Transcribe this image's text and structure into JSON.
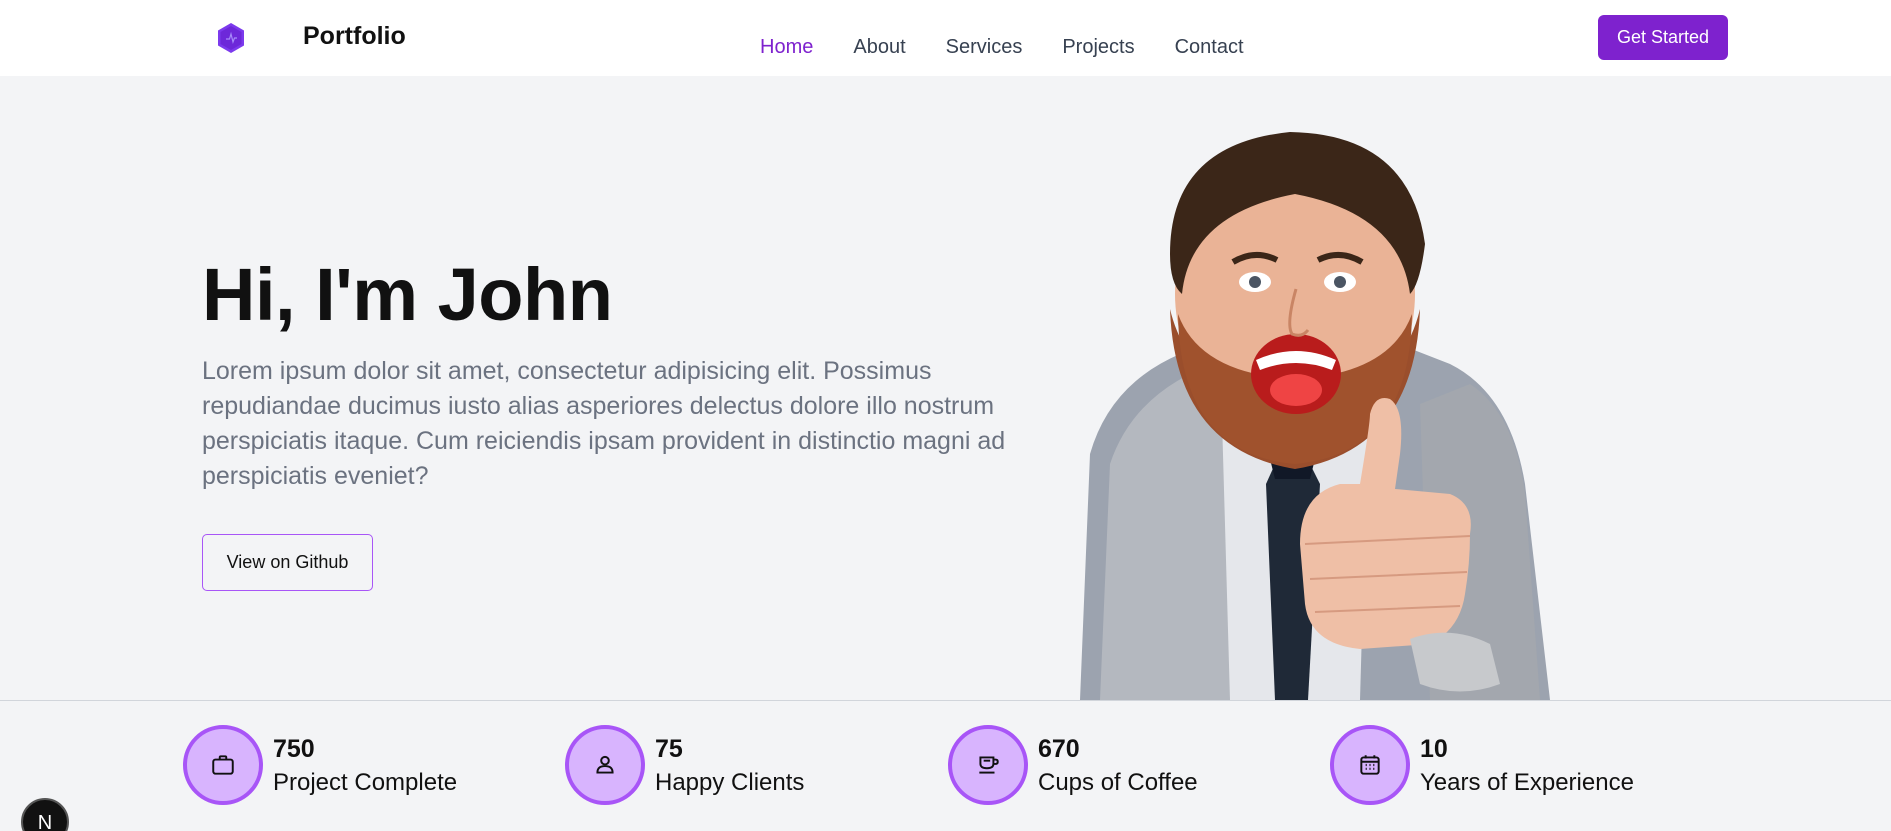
{
  "header": {
    "brand": "Portfolio",
    "nav": [
      {
        "label": "Home",
        "active": true
      },
      {
        "label": "About",
        "active": false
      },
      {
        "label": "Services",
        "active": false
      },
      {
        "label": "Projects",
        "active": false
      },
      {
        "label": "Contact",
        "active": false
      }
    ],
    "cta_label": "Get Started"
  },
  "hero": {
    "title": "Hi, I'm John",
    "description": "Lorem ipsum dolor sit amet, consectetur adipisicing elit. Possimus repudiandae ducimus iusto alias asperiores delectus dolore illo nostrum perspiciatis itaque. Cum reiciendis ipsam provident in distinctio magni ad perspiciatis eveniet?",
    "button_label": "View on Github"
  },
  "stats": [
    {
      "value": "750",
      "label": "Project Complete",
      "icon": "briefcase-icon"
    },
    {
      "value": "75",
      "label": "Happy Clients",
      "icon": "user-icon"
    },
    {
      "value": "670",
      "label": "Cups of Coffee",
      "icon": "coffee-cup-icon"
    },
    {
      "value": "10",
      "label": "Years of Experience",
      "icon": "calendar-icon"
    }
  ],
  "badge": "N",
  "colors": {
    "accent": "#7e22ce",
    "accent_light": "#d8b4fe",
    "accent_border": "#a855f7",
    "background": "#f3f4f6"
  }
}
